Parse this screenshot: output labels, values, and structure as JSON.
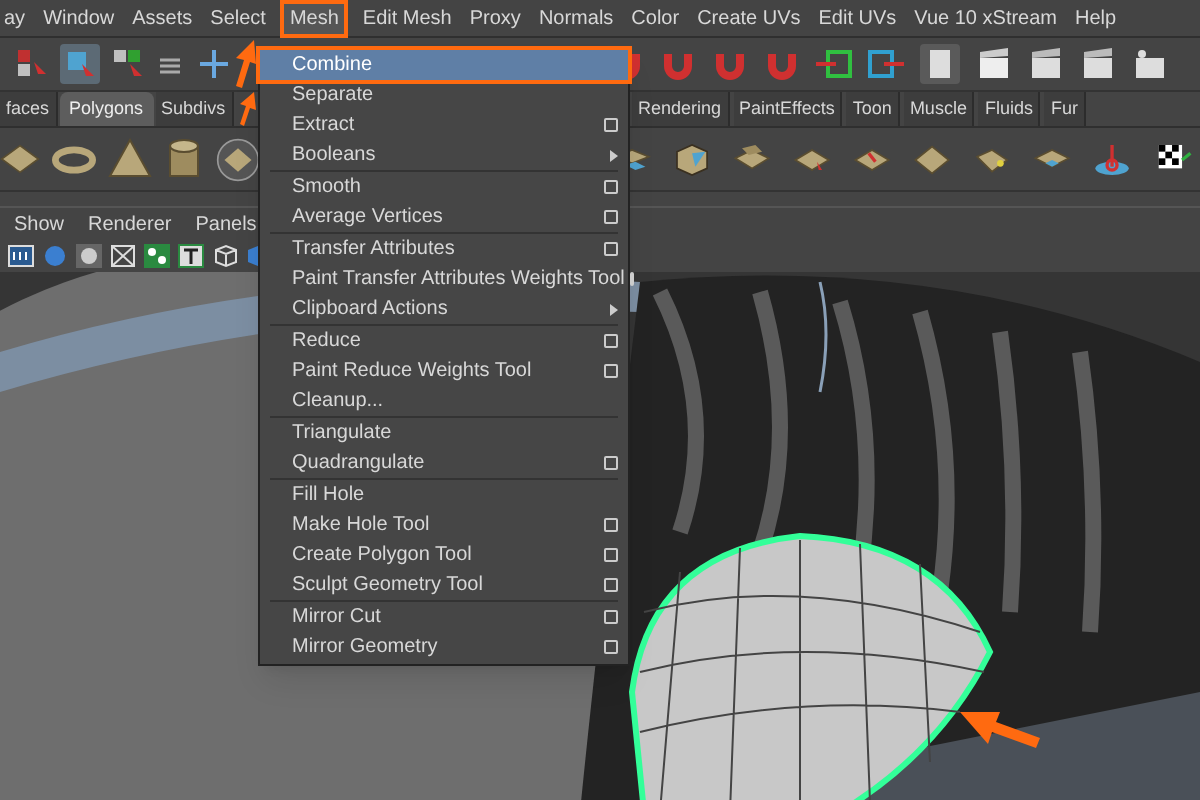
{
  "menu_bar": [
    {
      "label": "ay",
      "selected": false
    },
    {
      "label": "Window",
      "selected": false
    },
    {
      "label": "Assets",
      "selected": false
    },
    {
      "label": "Select",
      "selected": false
    },
    {
      "label": "Mesh",
      "selected": true
    },
    {
      "label": "Edit Mesh",
      "selected": false
    },
    {
      "label": "Proxy",
      "selected": false
    },
    {
      "label": "Normals",
      "selected": false
    },
    {
      "label": "Color",
      "selected": false
    },
    {
      "label": "Create UVs",
      "selected": false
    },
    {
      "label": "Edit UVs",
      "selected": false
    },
    {
      "label": "Vue 10 xStream",
      "selected": false
    },
    {
      "label": "Help",
      "selected": false
    }
  ],
  "shelf_tabs_left": [
    {
      "label": "faces",
      "selected": false
    },
    {
      "label": "Polygons",
      "selected": true
    },
    {
      "label": "Subdivs",
      "selected": false
    }
  ],
  "shelf_tabs_right": [
    {
      "label": "Rendering",
      "selected": false
    },
    {
      "label": "PaintEffects",
      "selected": false
    },
    {
      "label": "Toon",
      "selected": false
    },
    {
      "label": "Muscle",
      "selected": false
    },
    {
      "label": "Fluids",
      "selected": false
    },
    {
      "label": "Fur",
      "selected": false
    }
  ],
  "panel_menu": [
    "Show",
    "Renderer",
    "Panels"
  ],
  "mesh_menu": [
    [
      {
        "label": "Combine",
        "highlighted": true,
        "kind": "plain"
      },
      {
        "label": "Separate",
        "highlighted": false,
        "kind": "plain"
      },
      {
        "label": "Extract",
        "highlighted": false,
        "kind": "option"
      },
      {
        "label": "Booleans",
        "highlighted": false,
        "kind": "submenu"
      }
    ],
    [
      {
        "label": "Smooth",
        "highlighted": false,
        "kind": "option"
      },
      {
        "label": "Average Vertices",
        "highlighted": false,
        "kind": "option"
      }
    ],
    [
      {
        "label": "Transfer Attributes",
        "highlighted": false,
        "kind": "option"
      },
      {
        "label": "Paint Transfer Attributes Weights Tool",
        "highlighted": false,
        "kind": "option"
      },
      {
        "label": "Clipboard Actions",
        "highlighted": false,
        "kind": "submenu"
      }
    ],
    [
      {
        "label": "Reduce",
        "highlighted": false,
        "kind": "option"
      },
      {
        "label": "Paint Reduce Weights Tool",
        "highlighted": false,
        "kind": "option"
      },
      {
        "label": "Cleanup...",
        "highlighted": false,
        "kind": "plain"
      }
    ],
    [
      {
        "label": "Triangulate",
        "highlighted": false,
        "kind": "plain"
      },
      {
        "label": "Quadrangulate",
        "highlighted": false,
        "kind": "option"
      }
    ],
    [
      {
        "label": "Fill Hole",
        "highlighted": false,
        "kind": "plain"
      },
      {
        "label": "Make Hole Tool",
        "highlighted": false,
        "kind": "option"
      },
      {
        "label": "Create Polygon Tool",
        "highlighted": false,
        "kind": "option"
      },
      {
        "label": "Sculpt Geometry Tool",
        "highlighted": false,
        "kind": "option"
      }
    ],
    [
      {
        "label": "Mirror Cut",
        "highlighted": false,
        "kind": "option"
      },
      {
        "label": "Mirror Geometry",
        "highlighted": false,
        "kind": "option"
      }
    ]
  ]
}
